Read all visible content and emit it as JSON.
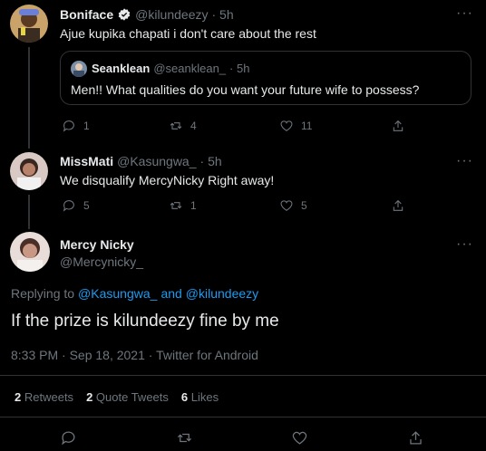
{
  "tweet1": {
    "name": "Boniface",
    "handle": "@kilundeezy",
    "time": "· 5h",
    "text": "Ajue kupika chapati i don't care about the rest",
    "quote": {
      "name": "Seanklean",
      "handle": "@seanklean_",
      "time": "· 5h",
      "text": "Men!! What qualities do you want your future wife to possess?"
    },
    "replies": "1",
    "retweets": "4",
    "likes": "11"
  },
  "tweet2": {
    "name": "MissMati",
    "handle": "@Kasungwa_",
    "time": "· 5h",
    "text": "We disqualify MercyNicky Right away!",
    "replies": "5",
    "retweets": "1",
    "likes": "5"
  },
  "main": {
    "name": "Mercy Nicky",
    "handle": "@Mercynicky_",
    "replying_prefix": "Replying to",
    "replying_user1": "@Kasungwa_",
    "replying_and": "and",
    "replying_user2": "@kilundeezy",
    "text": "If the prize is kilundeezy fine by me",
    "meta": "8:33 PM · Sep 18, 2021 · Twitter for Android",
    "retweets_count": "2",
    "retweets_label": "Retweets",
    "quotes_count": "2",
    "quotes_label": "Quote Tweets",
    "likes_count": "6",
    "likes_label": "Likes"
  },
  "more_glyph": "···",
  "colors": {
    "accent": "#1d9bf0",
    "muted": "#6e767d",
    "text": "#e7e9ea",
    "border": "#2f3336"
  }
}
